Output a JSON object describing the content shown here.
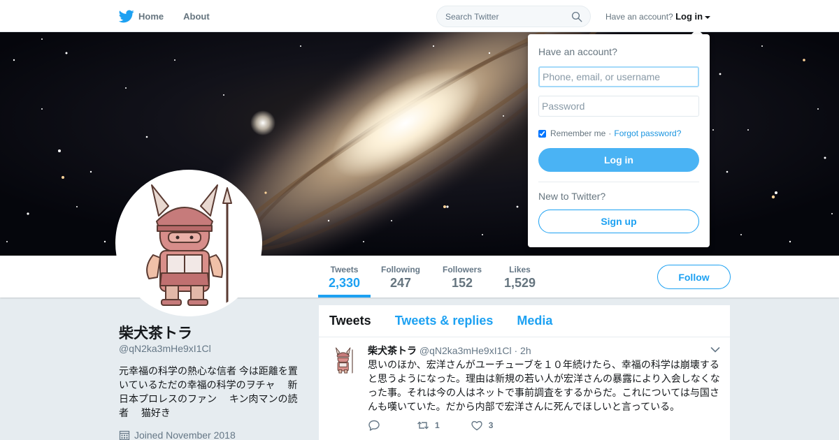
{
  "nav": {
    "logo_icon": "twitter-bird-icon",
    "home_label": "Home",
    "about_label": "About",
    "search_placeholder": "Search Twitter",
    "have_account": "Have an account?",
    "login_label": "Log in"
  },
  "login_dropdown": {
    "title": "Have an account?",
    "username_placeholder": "Phone, email, or username",
    "password_placeholder": "Password",
    "remember_label": "Remember me",
    "separator": "·",
    "forgot_label": "Forgot password?",
    "login_button": "Log in",
    "new_to_twitter": "New to Twitter?",
    "signup_button": "Sign up"
  },
  "profile": {
    "name": "柴犬茶トラ",
    "handle": "@qN2ka3mHe9xI1Cl",
    "bio": "元幸福の科学の熱心な信者 今は距離を置いているただの幸福の科学のヲチャ　 新日本プロレスのファン　 キン肉マンの読者　 猫好き",
    "joined": "Joined November 2018"
  },
  "stats": [
    {
      "label": "Tweets",
      "value": "2,330"
    },
    {
      "label": "Following",
      "value": "247"
    },
    {
      "label": "Followers",
      "value": "152"
    },
    {
      "label": "Likes",
      "value": "1,529"
    }
  ],
  "follow_button": "Follow",
  "tabs": [
    {
      "label": "Tweets"
    },
    {
      "label": "Tweets & replies"
    },
    {
      "label": "Media"
    }
  ],
  "tweet": {
    "name": "柴犬茶トラ",
    "meta": "@qN2ka3mHe9xI1Cl · 2h",
    "text": "思いのほか、宏洋さんがユーチューブを１０年続けたら、幸福の科学は崩壊すると思うようになった。理由は新規の若い人が宏洋さんの暴露により入会しなくなった事。それは今の人はネットで事前調査をするからだ。これについては与国さんも嘆いていた。だから内部で宏洋さんに死んでほしいと言っている。",
    "reply_count": "",
    "retweet_count": "1",
    "like_count": "3"
  },
  "colors": {
    "accent": "#1da1f2",
    "login_button": "#4ab3f4",
    "background": "#e6ecf0"
  }
}
